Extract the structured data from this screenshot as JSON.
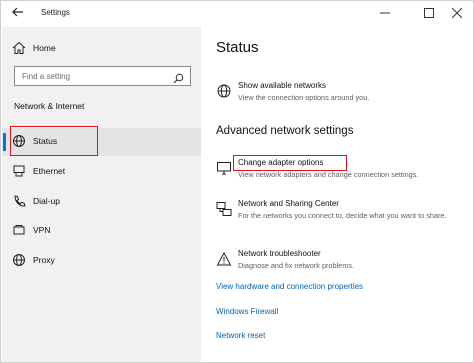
{
  "window": {
    "title": "Settings"
  },
  "sidebar": {
    "home_label": "Home",
    "search_placeholder": "Find a setting",
    "section_header": "Network & Internet",
    "items": [
      {
        "label": "Status",
        "icon": "globe-status-icon",
        "active": true
      },
      {
        "label": "Ethernet",
        "icon": "ethernet-icon"
      },
      {
        "label": "Dial-up",
        "icon": "phone-icon"
      },
      {
        "label": "VPN",
        "icon": "vpn-icon"
      },
      {
        "label": "Proxy",
        "icon": "globe-icon"
      }
    ]
  },
  "main": {
    "title": "Status",
    "available_networks": {
      "title": "Show available networks",
      "desc": "View the connection options around you."
    },
    "advanced_title": "Advanced network settings",
    "adapter": {
      "title": "Change adapter options",
      "desc": "View network adapters and change connection settings."
    },
    "sharing": {
      "title": "Network and Sharing Center",
      "desc": "For the networks you connect to, decide what you want to share."
    },
    "troubleshooter": {
      "title": "Network troubleshooter",
      "desc": "Diagnose and fix network problems."
    },
    "links": [
      "View hardware and connection properties",
      "Windows Firewall",
      "Network reset"
    ]
  },
  "colors": {
    "accent": "#0078d7",
    "link": "#0067b8",
    "highlight_box": "#e0141e"
  }
}
